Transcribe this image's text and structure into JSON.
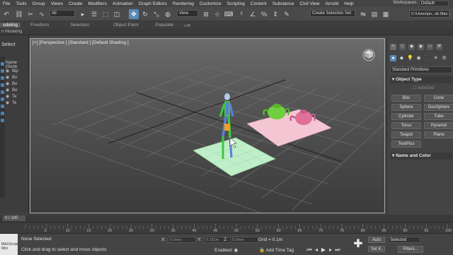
{
  "menu": [
    "File",
    "Tools",
    "Group",
    "Views",
    "Create",
    "Modifiers",
    "Animation",
    "Graph Editors",
    "Rendering",
    "Customize",
    "Scripting",
    "Content",
    "Substance",
    "Civil View",
    "Arnold",
    "Help"
  ],
  "workspaces": {
    "label": "Workspaces:",
    "value": "Default"
  },
  "toolbar": {
    "filter_value": "All",
    "view_value": "View",
    "selection_set_value": "Create Selection Set",
    "project_path": "C:\\Users\\po...ds Max 2"
  },
  "ribbon": {
    "tabs": [
      "odeling",
      "Freeform",
      "Selection",
      "Object Paint",
      "Populate"
    ],
    "sub_label": "n Modeling"
  },
  "explorer": {
    "title": "Select",
    "column_header": "Name (Sorte",
    "rows": [
      "Bip",
      "Bo",
      "Bo",
      "Bo",
      "Te",
      "Te"
    ]
  },
  "viewport": {
    "label": "[+] [Perspective ] [Standard ] [Default Shading ]"
  },
  "command_panel": {
    "tabs": [
      "+",
      "⬡",
      "◆",
      "◉",
      "▭",
      "⚒"
    ],
    "subtabs": [
      "●",
      "◆",
      "💡",
      "◉",
      "⬛",
      "✳",
      "⚙"
    ],
    "category": "Standard Primitives",
    "object_type_title": "Object Type",
    "autogrid_label": "AutoGrid",
    "primitives": [
      [
        "Box",
        "Cone"
      ],
      [
        "Sphere",
        "GeoSphere"
      ],
      [
        "Cylinder",
        "Tube"
      ],
      [
        "Torus",
        "Pyramid"
      ],
      [
        "Teapot",
        "Plane"
      ],
      [
        "TextPlus",
        ""
      ]
    ],
    "name_color_title": "Name and Color"
  },
  "timeline": {
    "frame_display": "0 / 100",
    "ticks": [
      "5",
      "10",
      "15",
      "20",
      "25",
      "30",
      "35",
      "40",
      "45",
      "50",
      "55",
      "60",
      "65",
      "70",
      "75",
      "80",
      "85",
      "90",
      "95",
      "100"
    ]
  },
  "status": {
    "mini_listener": "MAXScript Mini",
    "selection": "None Selected",
    "hint": "Click and drag to select and move objects",
    "x_label": "X:",
    "x_value": "0.0mm",
    "y_label": "Y:",
    "y_value": "0.161m",
    "z_label": "Z:",
    "z_value": "0.0mm",
    "grid": "Grid = 0.1m",
    "enabled": "Enabled:",
    "add_time_tag": "Add Time Tag",
    "auto_label": "Auto",
    "set_key_label": "Set K.",
    "selected_value": "Selected",
    "filters_label": "Filters..."
  },
  "colors": {
    "accent": "#5a8bb8",
    "teapot_green": "#6fcf3e",
    "teapot_pink": "#e0709a",
    "plane_pink": "#f4c6d4",
    "plane_green": "#bfeec8",
    "biped_green": "#3cc840",
    "biped_blue": "#5a7fd8"
  }
}
